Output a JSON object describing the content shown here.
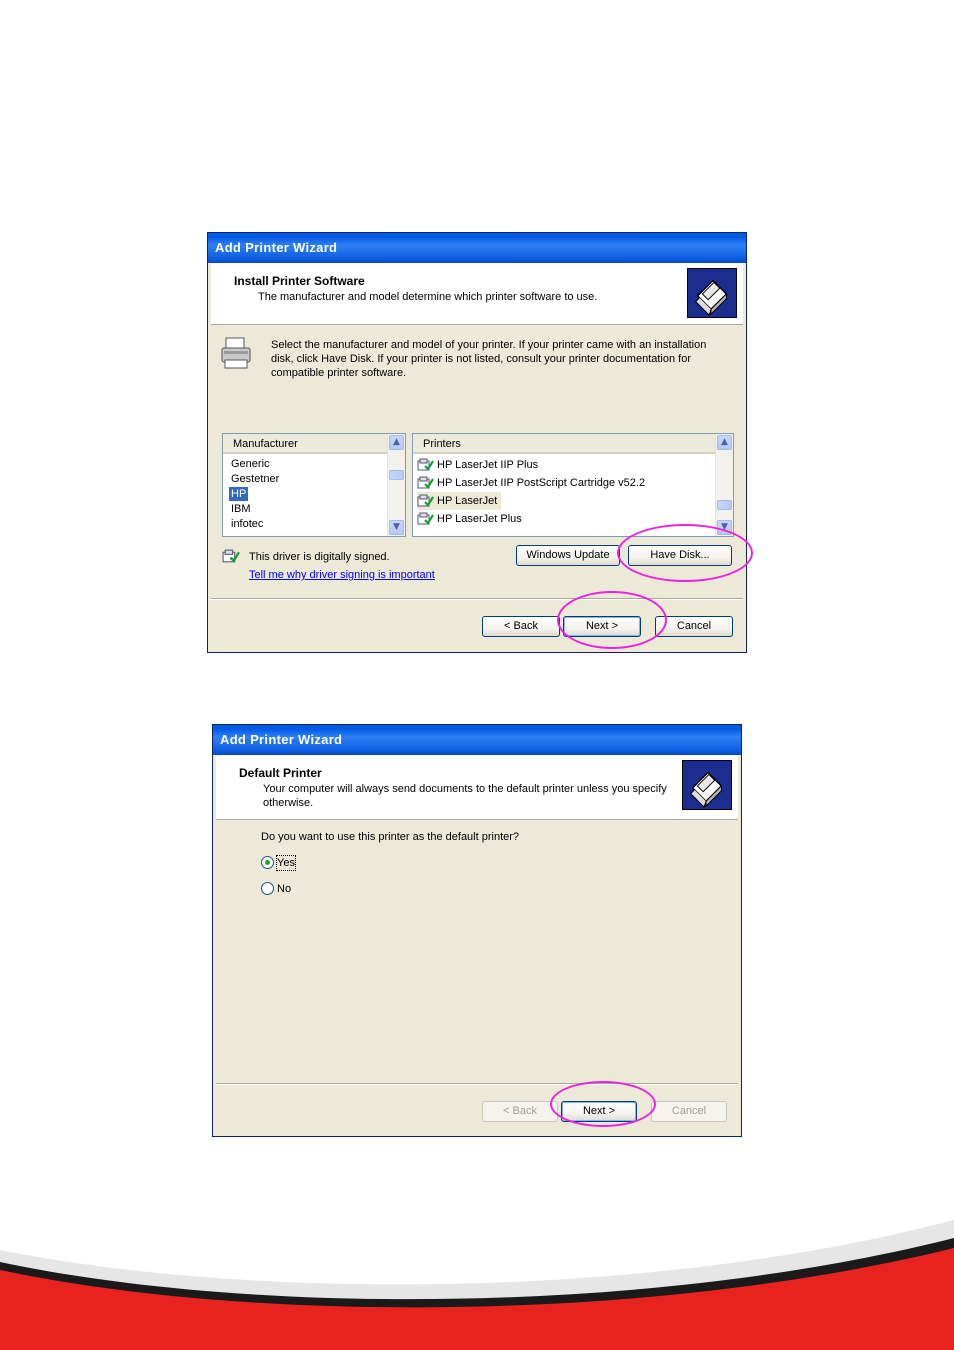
{
  "wizard1": {
    "title": "Add Printer Wizard",
    "header_title": "Install Printer Software",
    "header_subtitle": "The manufacturer and model determine which printer software to use.",
    "instructions": [
      "Select the manufacturer and model of your printer. If your printer came with an installation",
      "disk, click Have Disk. If your printer is not listed, consult your printer documentation for",
      "compatible printer software."
    ],
    "manufacturer_header": "Manufacturer",
    "manufacturers": [
      "Generic",
      "Gestetner",
      "HP",
      "IBM",
      "infotec"
    ],
    "selected_manufacturer": "HP",
    "printers_header": "Printers",
    "printers": [
      "HP LaserJet IIP Plus",
      "HP LaserJet IIP PostScript Cartridge v52.2",
      "HP LaserJet",
      "HP LaserJet Plus"
    ],
    "selected_printer": "HP LaserJet",
    "driver_signed_text": "This driver is digitally signed.",
    "driver_signing_link": "Tell me why driver signing is important",
    "windows_update_label": "Windows Update",
    "have_disk_label": "Have Disk...",
    "back_label": "< Back",
    "next_label": "Next >",
    "cancel_label": "Cancel"
  },
  "wizard2": {
    "title": "Add Printer Wizard",
    "header_title": "Default Printer",
    "header_subtitle": [
      "Your computer will always send documents to the default printer unless you specify",
      "otherwise."
    ],
    "question": "Do you want to use this printer as the default printer?",
    "yes_label": "Yes",
    "no_label": "No",
    "selected_option": "Yes",
    "back_label": "< Back",
    "next_label": "Next >",
    "cancel_label": "Cancel"
  },
  "colors": {
    "highlight_circle": "#ee22dd",
    "footer_red": "#e8231f",
    "titlebar_blue": "#0058e6",
    "selection_blue": "#316ac5"
  }
}
